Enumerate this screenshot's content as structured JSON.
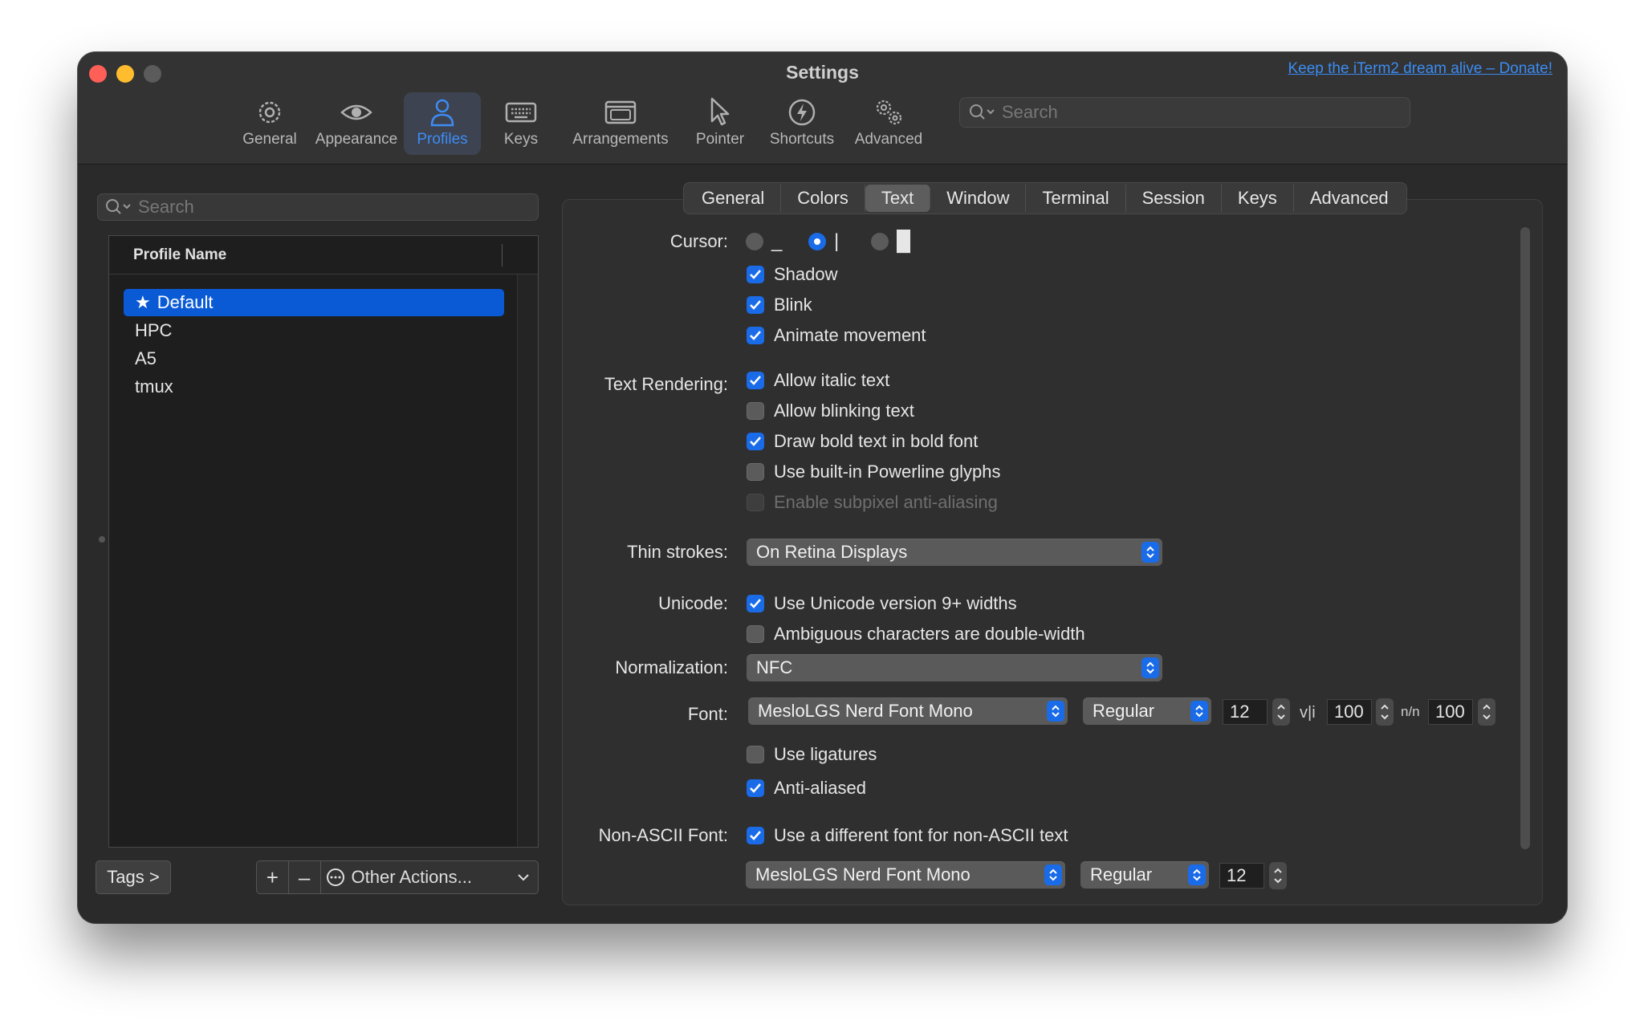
{
  "window": {
    "title": "Settings",
    "donate_link": "Keep the iTerm2 dream alive – Donate!"
  },
  "toolbar": {
    "items": [
      {
        "label": "General",
        "icon": "gear-icon"
      },
      {
        "label": "Appearance",
        "icon": "eye-icon"
      },
      {
        "label": "Profiles",
        "icon": "person-icon",
        "active": true
      },
      {
        "label": "Keys",
        "icon": "keyboard-icon"
      },
      {
        "label": "Arrangements",
        "icon": "windows-icon"
      },
      {
        "label": "Pointer",
        "icon": "pointer-icon"
      },
      {
        "label": "Shortcuts",
        "icon": "bolt-icon"
      },
      {
        "label": "Advanced",
        "icon": "gears-icon"
      }
    ],
    "search_placeholder": "Search"
  },
  "profiles": {
    "search_placeholder": "Search",
    "header": "Profile Name",
    "rows": [
      "Default",
      "HPC",
      "A5",
      "tmux"
    ],
    "selected": "Default",
    "tags_button": "Tags >",
    "add": "+",
    "remove": "–",
    "other_actions": "Other Actions..."
  },
  "tabs": [
    "General",
    "Colors",
    "Text",
    "Window",
    "Terminal",
    "Session",
    "Keys",
    "Advanced"
  ],
  "active_tab": "Text",
  "text_settings": {
    "cursor_label": "Cursor:",
    "cursor_options": [
      "_",
      "|",
      "█"
    ],
    "cursor_selected": 1,
    "shadow": "Shadow",
    "blink": "Blink",
    "animate": "Animate movement",
    "rendering_label": "Text Rendering:",
    "italic": "Allow italic text",
    "blinking": "Allow blinking text",
    "bold": "Draw bold text in bold font",
    "powerline": "Use built-in Powerline glyphs",
    "subpixel": "Enable subpixel anti-aliasing",
    "thin_label": "Thin strokes:",
    "thin_value": "On Retina Displays",
    "unicode_label": "Unicode:",
    "unicode9": "Use Unicode version 9+ widths",
    "ambiguous": "Ambiguous characters are double-width",
    "normalization_label": "Normalization:",
    "normalization_value": "NFC",
    "font_label": "Font:",
    "font_family": "MesloLGS Nerd Font Mono",
    "font_weight": "Regular",
    "font_size": "12",
    "v_spacing": "100",
    "h_spacing": "100",
    "ligatures": "Use ligatures",
    "antialiased": "Anti-aliased",
    "nonascii_label": "Non-ASCII Font:",
    "nonascii_check": "Use a different font for non-ASCII text",
    "nonascii_family": "MesloLGS Nerd Font Mono",
    "nonascii_weight": "Regular",
    "nonascii_size": "12",
    "v_symbol": "v|i",
    "h_symbol": "n/n"
  },
  "colors": {
    "accent": "#1a6be8",
    "selection": "#0a5ad6",
    "link": "#3b8cf3"
  }
}
